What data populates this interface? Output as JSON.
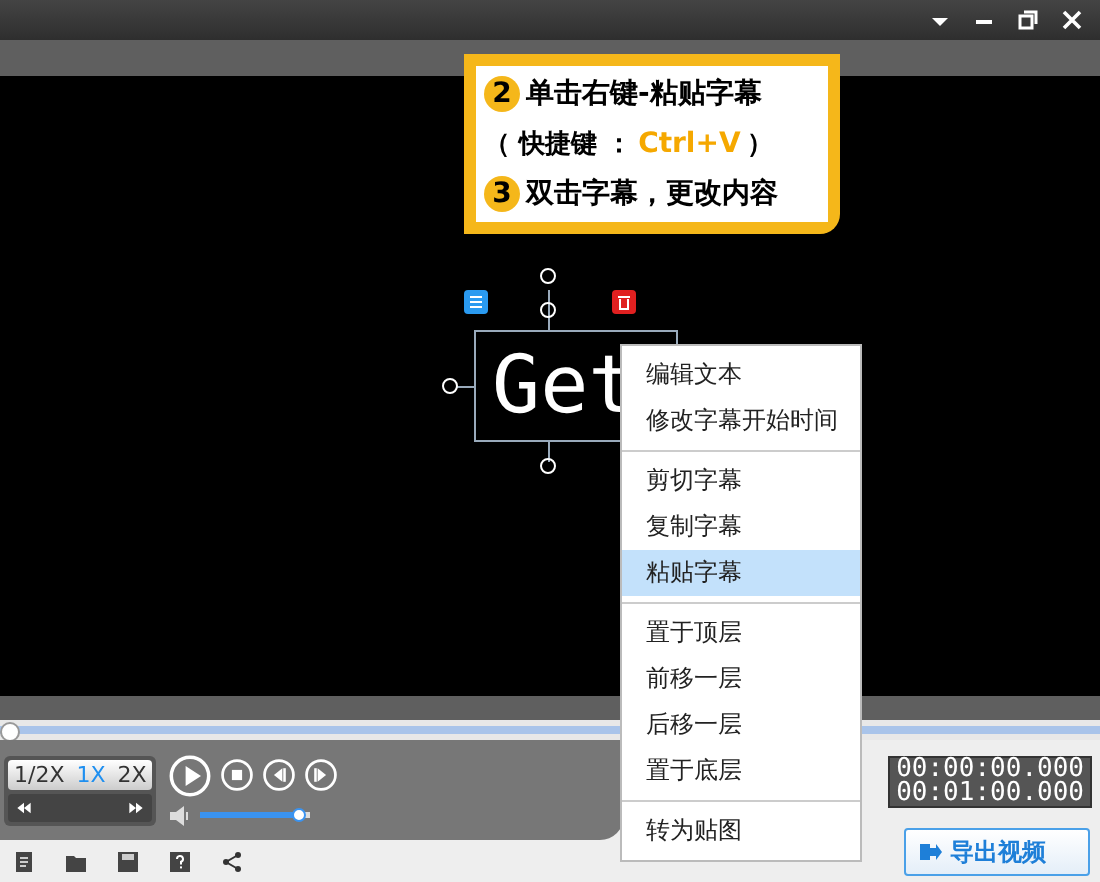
{
  "callout": {
    "steps": [
      {
        "number": "2",
        "text": "单击右键-粘贴字幕"
      },
      {
        "number": "3",
        "text": "双击字幕，更改内容"
      }
    ],
    "shortcut": {
      "open": "（ 快捷键 ：",
      "key": "Ctrl+V",
      "close": "）"
    }
  },
  "subtitle": {
    "text": "Get"
  },
  "context_menu": {
    "groups": [
      [
        {
          "label": "编辑文本",
          "selected": false
        },
        {
          "label": "修改字幕开始时间",
          "selected": false
        }
      ],
      [
        {
          "label": "剪切字幕",
          "selected": false
        },
        {
          "label": "复制字幕",
          "selected": false
        },
        {
          "label": "粘贴字幕",
          "selected": true
        }
      ],
      [
        {
          "label": "置于顶层",
          "selected": false
        },
        {
          "label": "前移一层",
          "selected": false
        },
        {
          "label": "后移一层",
          "selected": false
        },
        {
          "label": "置于底层",
          "selected": false
        }
      ],
      [
        {
          "label": "转为贴图",
          "selected": false
        }
      ]
    ]
  },
  "speeds": [
    {
      "label": "1/2X",
      "selected": false
    },
    {
      "label": "1X",
      "selected": true
    },
    {
      "label": "2X",
      "selected": false
    }
  ],
  "volume": {
    "level": 0.9
  },
  "time": {
    "current": "00:00:00.000",
    "total": "00:01:00.000"
  },
  "export_button": "导出视频"
}
